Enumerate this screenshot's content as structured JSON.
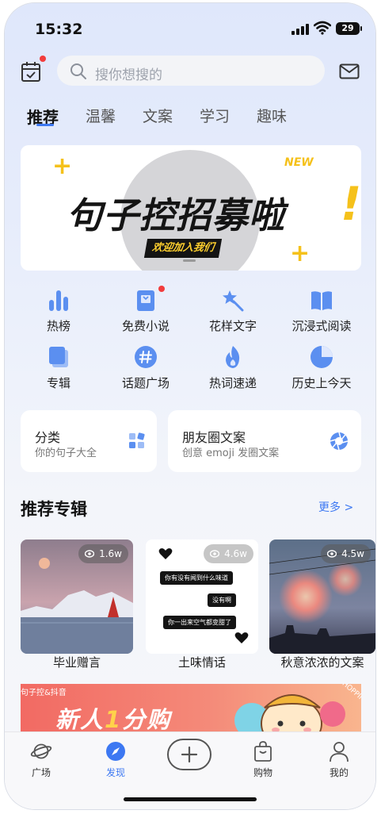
{
  "status_bar": {
    "time": "15:32",
    "battery": "29"
  },
  "header": {
    "search_placeholder": "搜你想搜的"
  },
  "tabs": [
    {
      "label": "推荐",
      "active": true
    },
    {
      "label": "温馨"
    },
    {
      "label": "文案"
    },
    {
      "label": "学习"
    },
    {
      "label": "趣味"
    }
  ],
  "banner": {
    "badge": "NEW",
    "title": "句子控招募啦",
    "subtitle": "欢迎加入我们"
  },
  "grid": [
    {
      "label": "热榜",
      "icon": "chart-bars-icon"
    },
    {
      "label": "免费小说",
      "icon": "book-icon"
    },
    {
      "label": "花样文字",
      "icon": "magic-wand-icon"
    },
    {
      "label": "沉浸式阅读",
      "icon": "open-book-icon"
    },
    {
      "label": "专辑",
      "icon": "album-icon"
    },
    {
      "label": "话题广场",
      "icon": "hashtag-icon"
    },
    {
      "label": "热词速递",
      "icon": "flame-icon"
    },
    {
      "label": "历史上今天",
      "icon": "pie-clock-icon"
    }
  ],
  "cards": [
    {
      "title": "分类",
      "subtitle": "你的句子大全"
    },
    {
      "title": "朋友圈文案",
      "subtitle": "创意 emoji 发圈文案"
    }
  ],
  "section": {
    "title": "推荐专辑",
    "more": "更多 >"
  },
  "albums": [
    {
      "label": "毕业赠言",
      "views": "1.6w"
    },
    {
      "label": "土味情话",
      "views": "4.6w",
      "lines": [
        "你有没有闻到什么味道",
        "没有啊",
        "你一出来空气都变甜了"
      ]
    },
    {
      "label": "秋意浓浓的文案",
      "views": "4.5w"
    }
  ],
  "promo": {
    "tag": "句子控&抖音",
    "text_a": "新人",
    "text_b": "1",
    "text_c": "分购",
    "side": "SHOPPING S"
  },
  "tabbar": [
    {
      "label": "广场",
      "icon": "planet-icon"
    },
    {
      "label": "发现",
      "icon": "compass-icon",
      "active": true
    },
    {
      "label": "",
      "icon": "plus-icon"
    },
    {
      "label": "购物",
      "icon": "shopping-bag-icon"
    },
    {
      "label": "我的",
      "icon": "profile-icon"
    }
  ],
  "colors": {
    "accent": "#3d78f2",
    "icon_blue": "#5b8ff0",
    "badge_red": "#f23c3c",
    "banner_yellow": "#f5c11b"
  }
}
